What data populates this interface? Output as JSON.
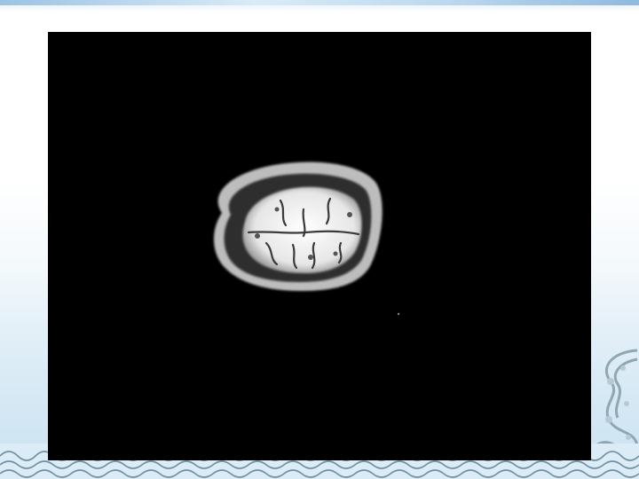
{
  "slide": {
    "image_subject": "axial-brain-mri-scan",
    "accent_color": "#9cc3e4",
    "background_color": "#ffffff",
    "scan_background_color": "#000000"
  }
}
